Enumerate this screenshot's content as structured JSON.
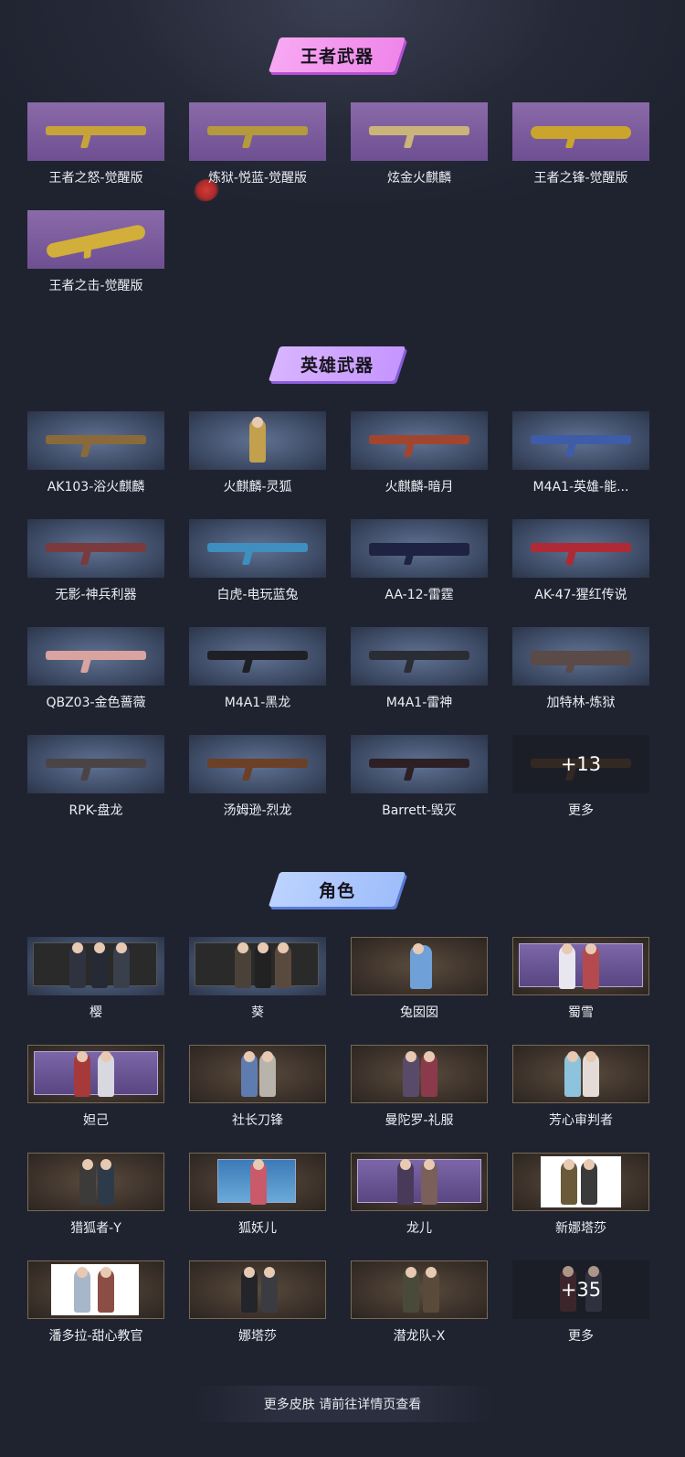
{
  "sections": {
    "king": {
      "title": "王者武器",
      "items": [
        {
          "name": "王者之怒-觉醒版"
        },
        {
          "name": "炼狱-悦蓝-觉醒版"
        },
        {
          "name": "炫金火麒麟"
        },
        {
          "name": "王者之锋-觉醒版"
        },
        {
          "name": "王者之击-觉醒版"
        }
      ]
    },
    "hero": {
      "title": "英雄武器",
      "items": [
        {
          "name": "AK103-浴火麒麟"
        },
        {
          "name": "火麒麟-灵狐"
        },
        {
          "name": "火麒麟-暗月"
        },
        {
          "name": "M4A1-英雄-能..."
        },
        {
          "name": "无影-神兵利器"
        },
        {
          "name": "白虎-电玩蓝兔"
        },
        {
          "name": "AA-12-雷霆"
        },
        {
          "name": "AK-47-猩红传说"
        },
        {
          "name": "QBZ03-金色蔷薇"
        },
        {
          "name": "M4A1-黑龙"
        },
        {
          "name": "M4A1-雷神"
        },
        {
          "name": "加特林-炼狱"
        },
        {
          "name": "RPK-盘龙"
        },
        {
          "name": "汤姆逊-烈龙"
        },
        {
          "name": "Barrett-毁灭"
        },
        {
          "name": "更多",
          "more_count": "+13"
        }
      ]
    },
    "role": {
      "title": "角色",
      "items": [
        {
          "name": "樱"
        },
        {
          "name": "葵"
        },
        {
          "name": "兔囡囡"
        },
        {
          "name": "蜀雪"
        },
        {
          "name": "妲己"
        },
        {
          "name": "社长刀锋"
        },
        {
          "name": "曼陀罗-礼服"
        },
        {
          "name": "芳心审判者"
        },
        {
          "name": "猎狐者-Y"
        },
        {
          "name": "狐妖儿"
        },
        {
          "name": "龙儿"
        },
        {
          "name": "新娜塔莎"
        },
        {
          "name": "潘多拉-甜心教官"
        },
        {
          "name": "娜塔莎"
        },
        {
          "name": "潜龙队-X"
        },
        {
          "name": "更多",
          "more_count": "+35"
        }
      ]
    }
  },
  "footer": {
    "text": "更多皮肤 请前往详情页查看"
  },
  "colors": {
    "background": "#1f2330",
    "banner_king": "#ef86ea",
    "banner_hero": "#c596ff",
    "banner_role": "#9fbdfb"
  }
}
